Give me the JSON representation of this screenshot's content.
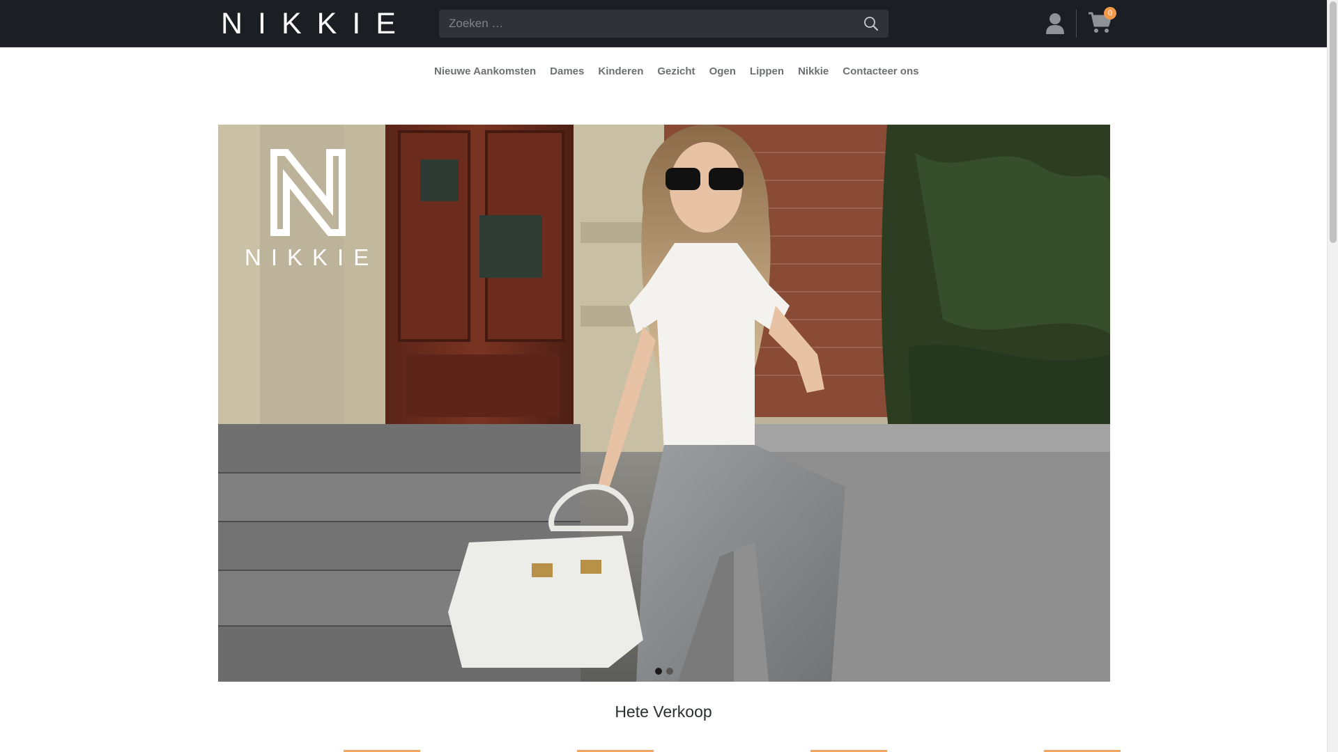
{
  "header": {
    "brand": "NIKKIE",
    "search_placeholder": "Zoeken …",
    "cart_count": "0"
  },
  "nav": {
    "items": [
      {
        "label": "Nieuwe Aankomsten"
      },
      {
        "label": "Dames"
      },
      {
        "label": "Kinderen"
      },
      {
        "label": "Gezicht"
      },
      {
        "label": "Ogen"
      },
      {
        "label": "Lippen"
      },
      {
        "label": "Nikkie"
      },
      {
        "label": "Contacteer ons"
      }
    ]
  },
  "hero": {
    "brand_mark": "N",
    "brand_word": "NIKKIE",
    "slides_total": 2,
    "active_slide": 1
  },
  "section": {
    "title": "Hete Verkoop"
  },
  "colors": {
    "topbar": "#1b1e22",
    "accent": "#f39a4a",
    "nav_text": "#6d6f73"
  }
}
